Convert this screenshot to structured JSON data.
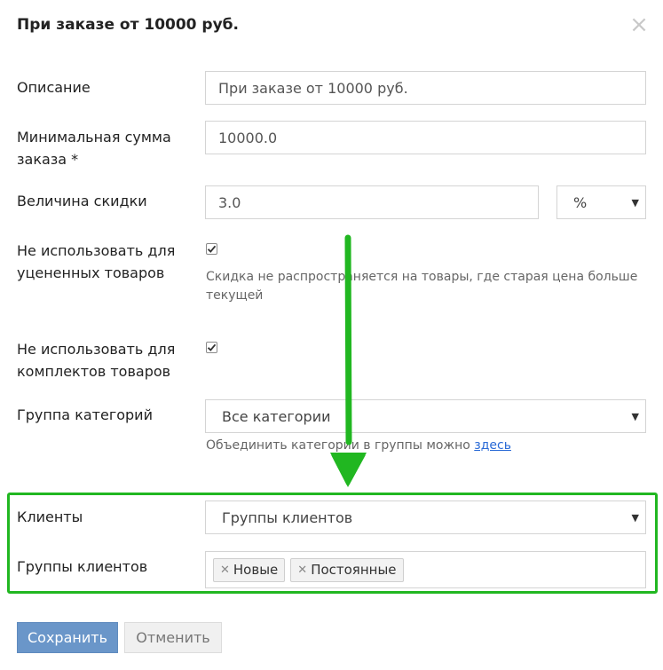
{
  "modal": {
    "title": "При заказе от 10000 руб.",
    "close_symbol": "×"
  },
  "form": {
    "description": {
      "label": "Описание",
      "value": "При заказе от 10000 руб."
    },
    "min_sum": {
      "label_line1": "Минимальная сумма",
      "label_line2": "заказа *",
      "value": "10000.0"
    },
    "discount": {
      "label": "Величина скидки",
      "value": "3.0",
      "unit_selected": "%"
    },
    "no_discounted": {
      "label_line1": "Не использовать для",
      "label_line2": "уцененных товаров",
      "checked": true,
      "hint_line1": "Скидка не распространяется на товары, где старая цена больше",
      "hint_line2": "текущей"
    },
    "no_bundles": {
      "label_line1": "Не использовать для",
      "label_line2": "комплектов товаров",
      "checked": true
    },
    "category_group": {
      "label": "Группа категорий",
      "selected": "Все категории",
      "hint_text": "Объединить категории в группы можно ",
      "hint_link": "здесь"
    },
    "clients": {
      "label": "Клиенты",
      "selected": "Группы клиентов"
    },
    "client_groups": {
      "label": "Группы клиентов",
      "tags": [
        "Новые",
        "Постоянные"
      ]
    }
  },
  "actions": {
    "save_label": "Сохранить",
    "cancel_label": "Отменить"
  },
  "colors": {
    "primary_button": "#6a96c9",
    "highlight": "#21b721",
    "link": "#2a6ad6"
  }
}
